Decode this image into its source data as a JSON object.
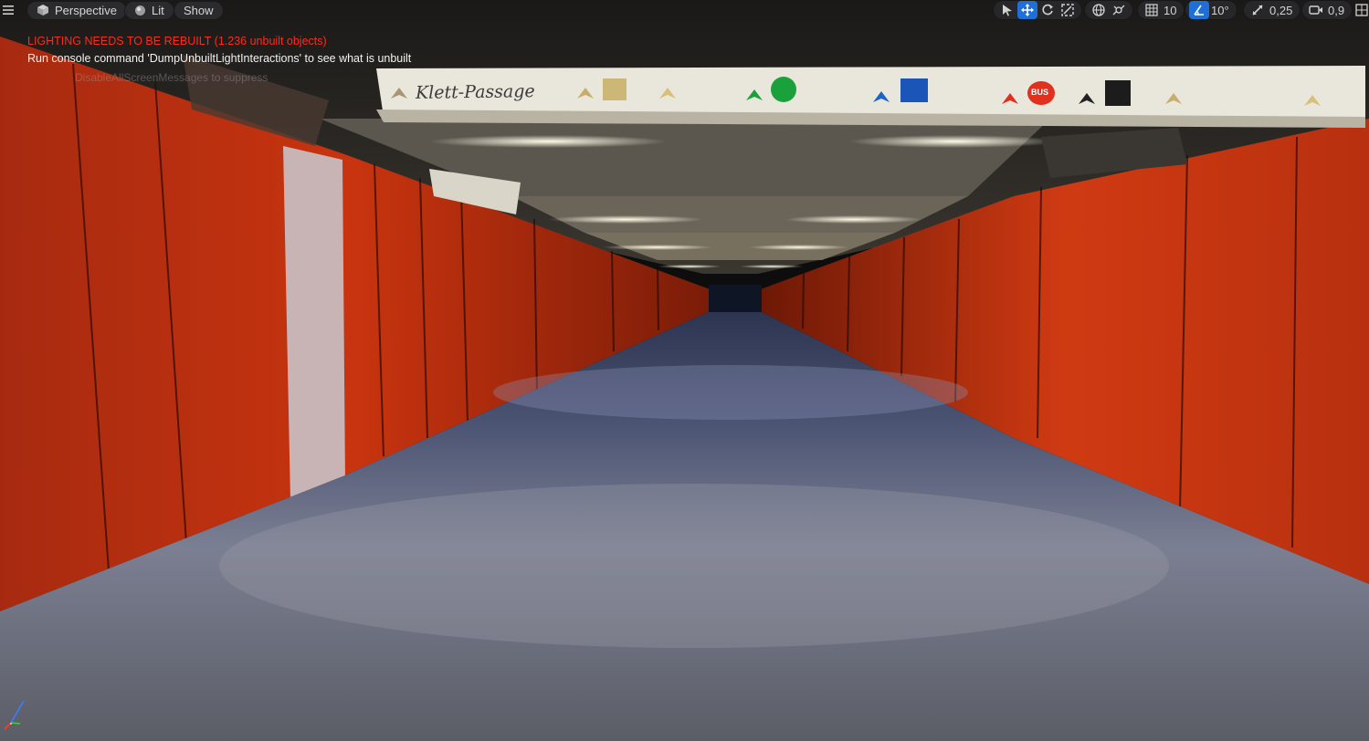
{
  "toolbar": {
    "menu_icon": "hamburger-icon",
    "view_mode": "Perspective",
    "lighting_mode": "Lit",
    "show_label": "Show",
    "grid_snap_value": "10",
    "rotation_snap_value": "10°",
    "scale_snap_value": "0,25",
    "camera_speed_value": "0,9",
    "accent_color": "#1f6fd6"
  },
  "viewport": {
    "warning_text": "LIGHTING NEEDS TO BE REBUILT (1.236 unbuilt objects)",
    "hint_text": "Run console command 'DumpUnbuiltLightInteractions' to see what is unbuilt",
    "faint_text": "DisableAllScreenMessages to suppress",
    "warning_color": "#ff2a1f"
  },
  "scene": {
    "sign_name": "Klett-Passage",
    "bus_label": "BUS",
    "wall_color": "#c0300f",
    "floor_color": "#6b7088"
  }
}
